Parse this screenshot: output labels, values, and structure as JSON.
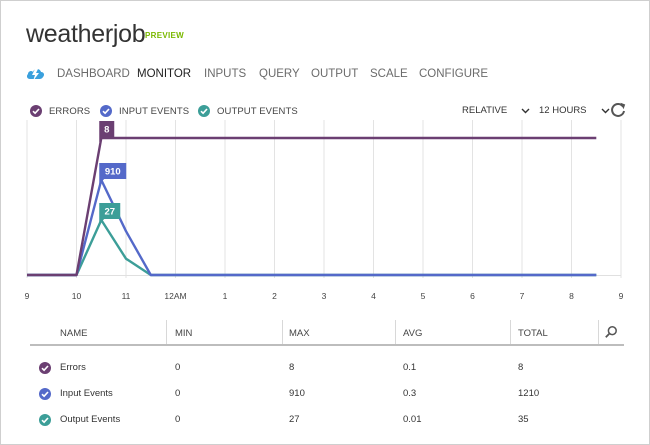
{
  "header": {
    "title": "weatherjob",
    "badge": "PREVIEW"
  },
  "nav": {
    "icon": "cloud-stream-icon",
    "tabs": [
      {
        "label": "DASHBOARD",
        "active": false
      },
      {
        "label": "MONITOR",
        "active": true
      },
      {
        "label": "INPUTS",
        "active": false
      },
      {
        "label": "QUERY",
        "active": false
      },
      {
        "label": "OUTPUT",
        "active": false
      },
      {
        "label": "SCALE",
        "active": false
      },
      {
        "label": "CONFIGURE",
        "active": false
      }
    ]
  },
  "legend": [
    {
      "label": "ERRORS",
      "color": "#6b3f72"
    },
    {
      "label": "INPUT EVENTS",
      "color": "#5469c9"
    },
    {
      "label": "OUTPUT EVENTS",
      "color": "#3c9e98"
    }
  ],
  "controls": {
    "time_mode": "RELATIVE",
    "range": "12 HOURS"
  },
  "chart_data": {
    "type": "line",
    "categories": [
      "9",
      "10",
      "11",
      "12AM",
      "1",
      "2",
      "3",
      "4",
      "5",
      "6",
      "7",
      "8",
      "9"
    ],
    "x_ticks": [
      0,
      1,
      2,
      3,
      4,
      5,
      6,
      7,
      8,
      9,
      10,
      11,
      12
    ],
    "grid": true,
    "series": [
      {
        "name": "Errors",
        "color": "#6b3f72",
        "x": [
          0,
          1,
          1.5,
          11.5
        ],
        "values": [
          0,
          0,
          8,
          8
        ],
        "callout": "8",
        "peak_index": 2
      },
      {
        "name": "Input Events",
        "color": "#5469c9",
        "x": [
          0,
          1,
          1.5,
          2,
          2.5,
          11.5
        ],
        "values": [
          0,
          0,
          910,
          420,
          0,
          0
        ],
        "callout": "910",
        "peak_index": 2
      },
      {
        "name": "Output Events",
        "color": "#3c9e98",
        "x": [
          0,
          1,
          1.5,
          2,
          2.5,
          11.5
        ],
        "values": [
          0,
          0,
          27,
          8,
          0,
          0
        ],
        "callout": "27",
        "peak_index": 2
      }
    ]
  },
  "table": {
    "headers": [
      "NAME",
      "MIN",
      "MAX",
      "AVG",
      "TOTAL"
    ],
    "rows": [
      {
        "name": "Errors",
        "min": "0",
        "max": "8",
        "avg": "0.1",
        "total": "8",
        "color": "#6b3f72"
      },
      {
        "name": "Input Events",
        "min": "0",
        "max": "910",
        "avg": "0.3",
        "total": "1210",
        "color": "#5469c9"
      },
      {
        "name": "Output Events",
        "min": "0",
        "max": "27",
        "avg": "0.01",
        "total": "35",
        "color": "#3c9e98"
      }
    ]
  }
}
